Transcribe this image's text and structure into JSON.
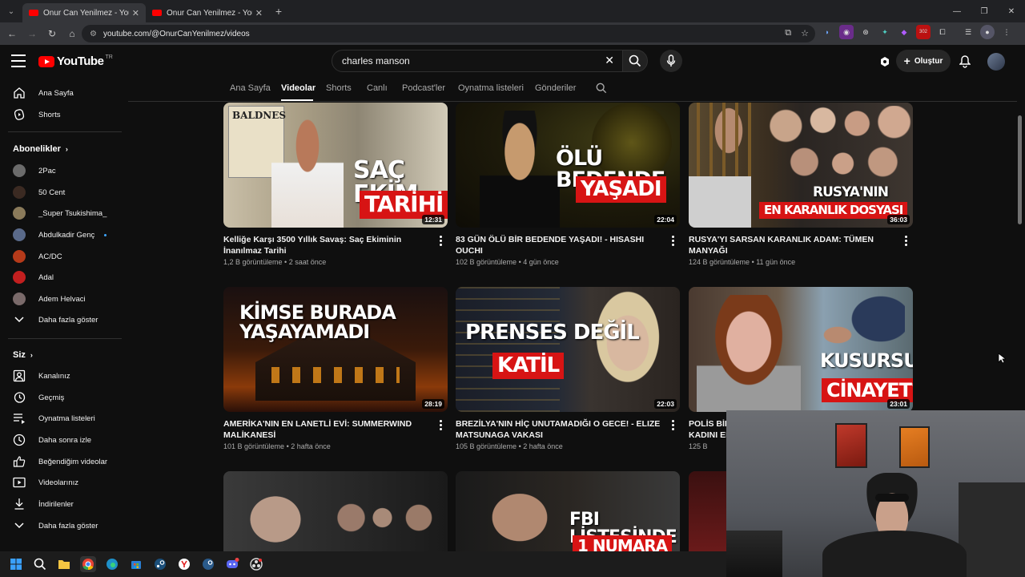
{
  "browser": {
    "tabs": [
      {
        "title": "Onur Can Yenilmez - YouTube",
        "active": true
      },
      {
        "title": "Onur Can Yenilmez - YouTube",
        "active": false
      }
    ],
    "url": "youtube.com/@OnurCanYenilmez/videos",
    "extension_badge": "302"
  },
  "header": {
    "logo_text": "YouTube",
    "country_code": "TR",
    "search_value": "charles manson",
    "create_label": "Oluştur"
  },
  "sidebar": {
    "main": [
      {
        "label": "Ana Sayfa",
        "icon": "home-icon"
      },
      {
        "label": "Shorts",
        "icon": "shorts-icon"
      }
    ],
    "subscriptions_title": "Abonelikler",
    "subscriptions": [
      {
        "label": "2Pac",
        "color": "#6b6b6b"
      },
      {
        "label": "50 Cent",
        "color": "#3b2a22"
      },
      {
        "label": "_Super Tsukishima_",
        "color": "#8a7a5a"
      },
      {
        "label": "Abdulkadir Genç",
        "color": "#5a6a8a",
        "new": true
      },
      {
        "label": "AC/DC",
        "color": "#b53a1a"
      },
      {
        "label": "Adal",
        "color": "#c21f1f"
      },
      {
        "label": "Adem Helvaci",
        "color": "#7a6a6a"
      }
    ],
    "show_more_1": "Daha fazla göster",
    "you_title": "Siz",
    "you": [
      {
        "label": "Kanalınız",
        "icon": "channel-icon"
      },
      {
        "label": "Geçmiş",
        "icon": "history-icon"
      },
      {
        "label": "Oynatma listeleri",
        "icon": "playlists-icon"
      },
      {
        "label": "Daha sonra izle",
        "icon": "watch-later-icon"
      },
      {
        "label": "Beğendiğim videolar",
        "icon": "liked-icon"
      },
      {
        "label": "Videolarınız",
        "icon": "your-videos-icon"
      },
      {
        "label": "İndirilenler",
        "icon": "downloads-icon"
      }
    ],
    "show_more_2": "Daha fazla göster"
  },
  "channel_tabs": [
    "Ana Sayfa",
    "Videolar",
    "Shorts",
    "Canlı",
    "Podcast'ler",
    "Oynatma listeleri",
    "Gönderiler"
  ],
  "videos": [
    {
      "title": "Kelliğe Karşı 3500 Yıllık Savaş: Saç Ekiminin İnanılmaz Tarihi",
      "views": "1,2 B görüntüleme",
      "age": "2 saat önce",
      "duration": "12:31",
      "caption1": "SAÇ EKİM",
      "caption2": "TARİHİ",
      "poster_text": "BALDNES"
    },
    {
      "title": "83 GÜN ÖLÜ BİR BEDENDE YAŞADI! - HISASHI OUCHI",
      "views": "102 B görüntüleme",
      "age": "4 gün önce",
      "duration": "22:04",
      "caption1": "ÖLÜ BEDENDE",
      "caption2": "YAŞADI"
    },
    {
      "title": "RUSYA'YI SARSAN KARANLIK ADAM: TÜMEN MANYAĞI",
      "views": "124 B görüntüleme",
      "age": "11 gün önce",
      "duration": "36:03",
      "caption1": "RUSYA'NIN",
      "caption2": "EN KARANLIK DOSYASI"
    },
    {
      "title": "AMERİKA'NIN EN LANETLİ EVİ: SUMMERWIND MALİKANESİ",
      "views": "101 B görüntüleme",
      "age": "2 hafta önce",
      "duration": "28:19",
      "caption1": "KİMSE BURADA YAŞAYAMADI"
    },
    {
      "title": "BREZİLYA'NIN HİÇ UNUTAMADIĞI O GECE! - ELIZE MATSUNAGA VAKASI",
      "views": "105 B görüntüleme",
      "age": "2 hafta önce",
      "duration": "22:03",
      "caption1": "PRENSES DEĞİL",
      "caption2": "KATİL"
    },
    {
      "title": "POLİS BİL",
      "title2": "KADINI EF",
      "views": "125 B",
      "age": "",
      "duration": "23:01",
      "caption1": "KUSURSUZ",
      "caption2": "CİNAYET?"
    },
    {
      "title": "",
      "views": "",
      "age": "",
      "duration": "",
      "caption1": ""
    },
    {
      "title": "",
      "views": "",
      "age": "",
      "duration": "",
      "caption1": "FBI LİSTESİNDE",
      "caption2": "1 NUMARA"
    }
  ]
}
